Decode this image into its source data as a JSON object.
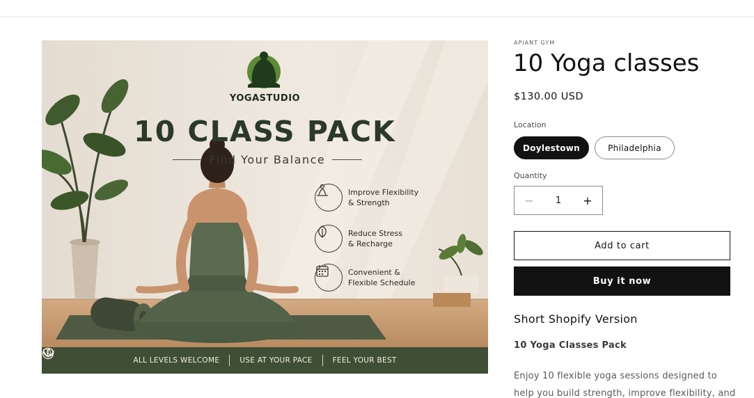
{
  "product": {
    "vendor": "APIANT GYM",
    "title": "10 Yoga classes",
    "price": "$130.00 USD"
  },
  "options": {
    "location_label": "Location",
    "locations": [
      "Doylestown",
      "Philadelphia"
    ],
    "selected_location": "Doylestown"
  },
  "quantity": {
    "label": "Quantity",
    "value": "1",
    "decrease_icon": "minus-icon",
    "increase_icon": "plus-icon"
  },
  "buttons": {
    "add_to_cart": "Add to cart",
    "buy_now": "Buy it now"
  },
  "description": {
    "heading": "Short Shopify Version",
    "subheading": "10 Yoga Classes Pack",
    "body": "Enjoy 10 flexible yoga sessions designed to help you build strength, improve flexibility, and"
  },
  "image": {
    "logo_icon": "meditating-figure-logo",
    "studio_name": "YOGASTUDIO",
    "headline": "10 CLASS PACK",
    "tagline": "Find Your Balance",
    "features": [
      {
        "icon": "meditation-icon",
        "line1": "Improve Flexibility",
        "line2": "& Strength"
      },
      {
        "icon": "leaf-icon",
        "line1": "Reduce Stress",
        "line2": "& Recharge"
      },
      {
        "icon": "calendar-icon",
        "line1": "Convenient &",
        "line2": "Flexible Schedule"
      }
    ],
    "banner": [
      {
        "icon": "lotus-icon",
        "label": "ALL LEVELS WELCOME"
      },
      {
        "icon": "clock-icon",
        "label": "USE AT YOUR PACE"
      },
      {
        "icon": "heart-icon",
        "label": "FEEL YOUR BEST"
      }
    ],
    "colors": {
      "banner_bg": "#3f4f35",
      "wall": "#e9e2d9",
      "floor": "#c79c72",
      "mat": "#4f5a44",
      "outfit": "#4a5a43"
    }
  },
  "theme": {
    "primary": "#121212",
    "text_muted": "#5a5a5a",
    "border": "#8a8a8a"
  }
}
